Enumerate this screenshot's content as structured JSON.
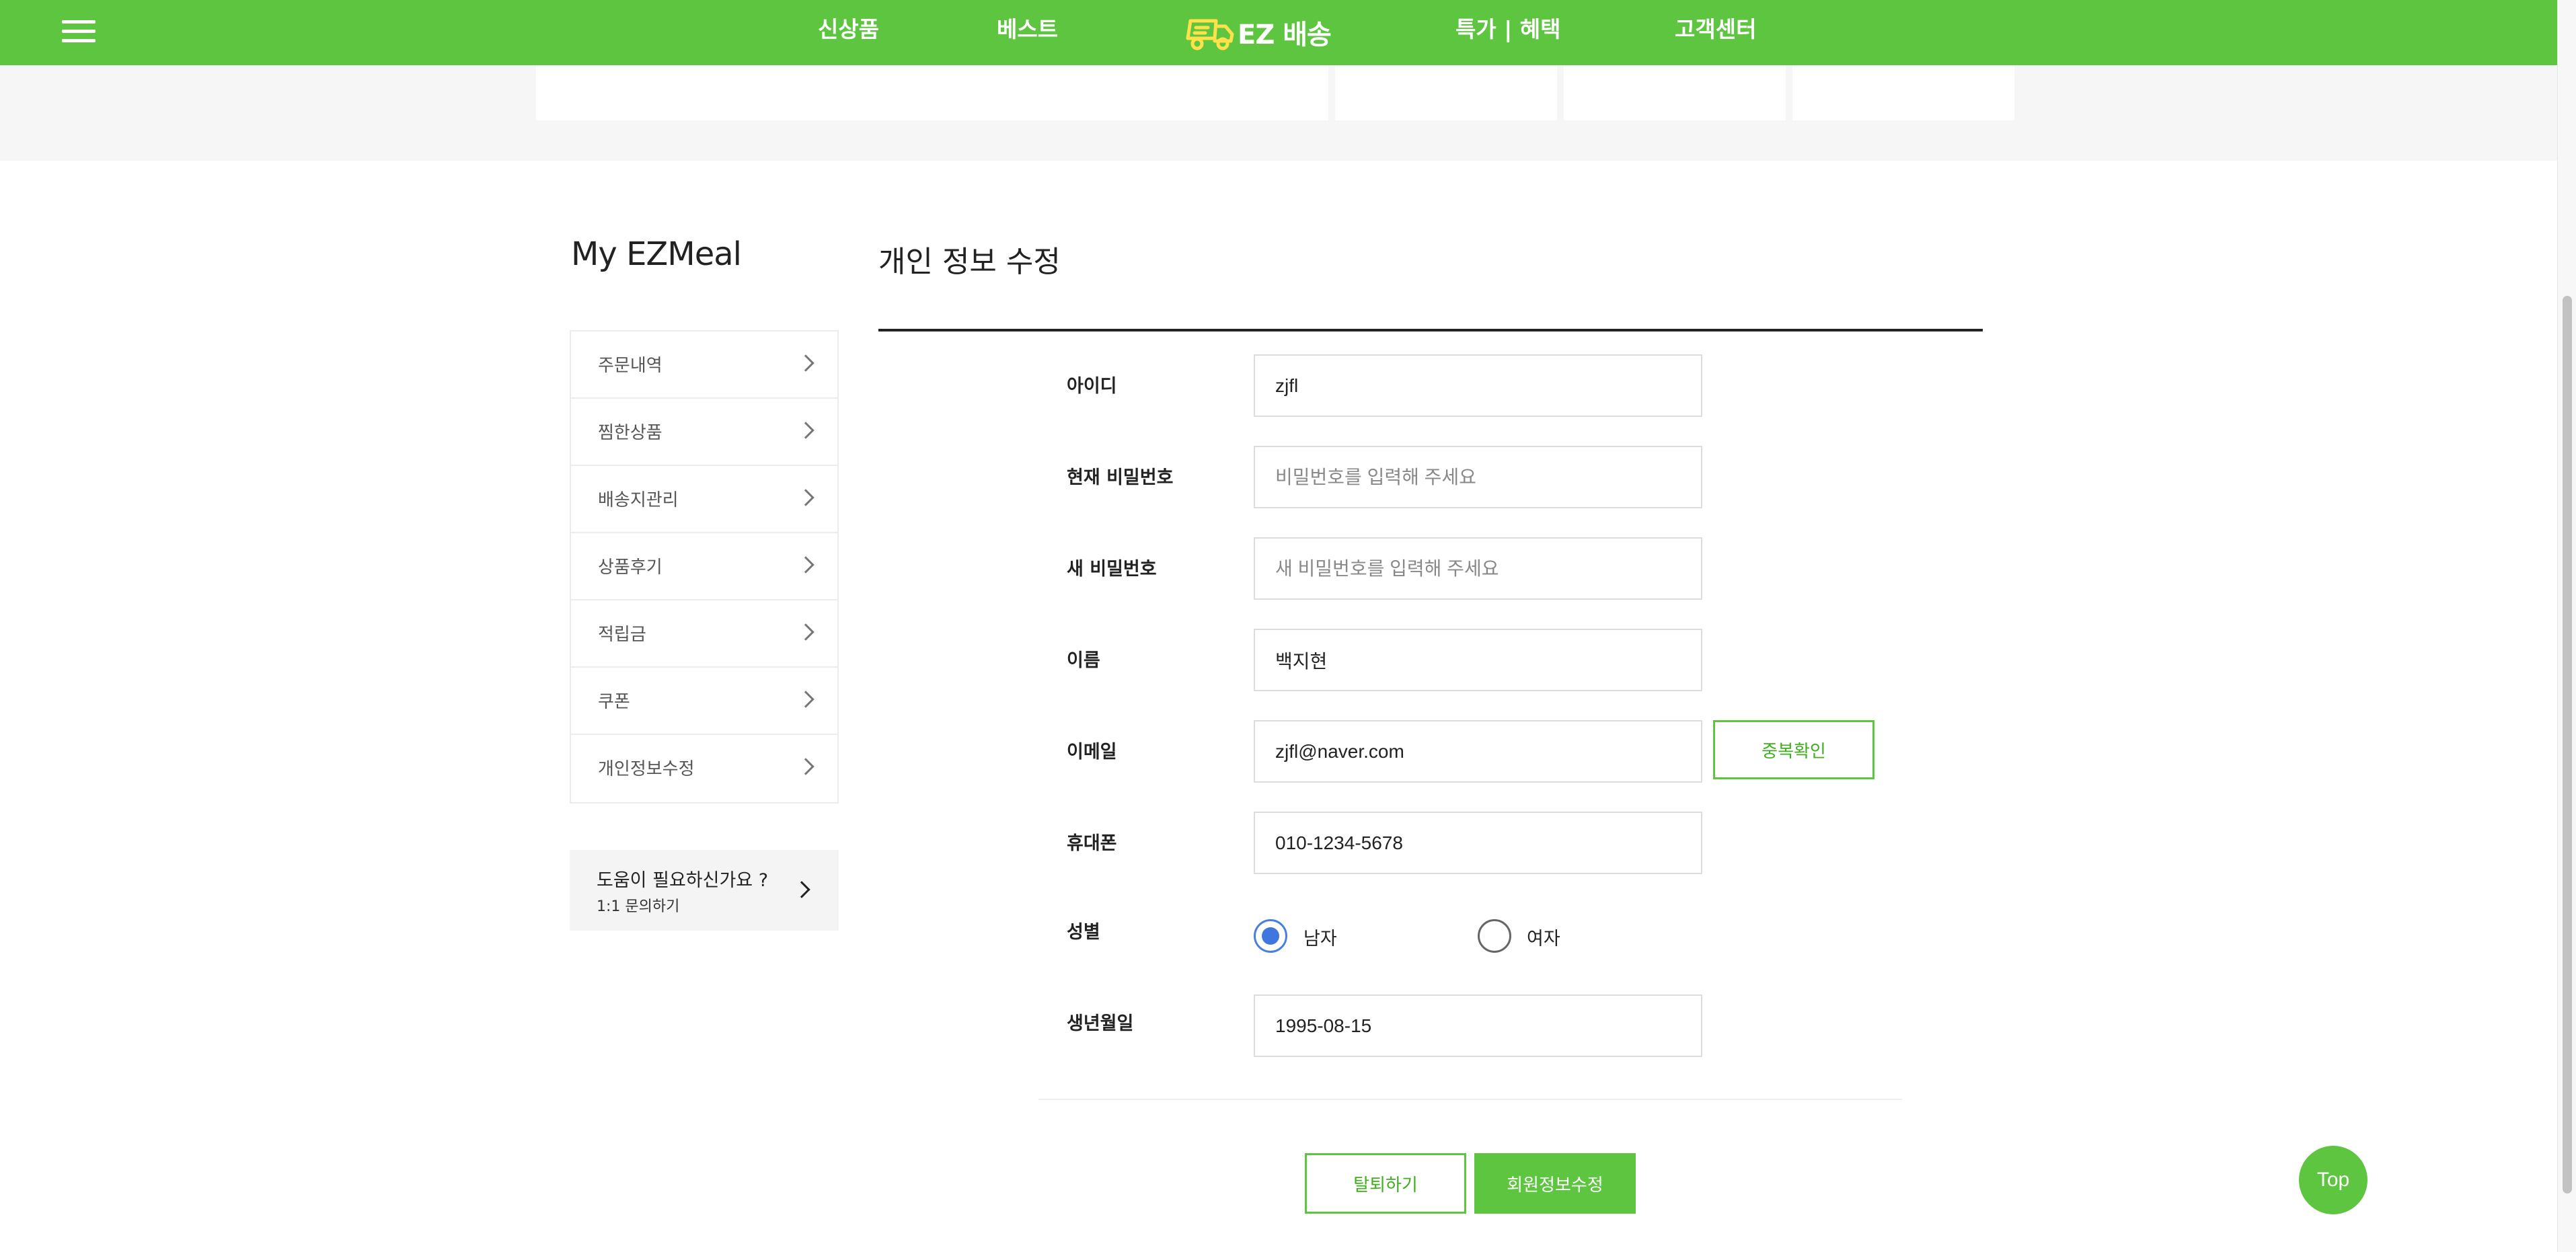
{
  "header": {
    "nav": [
      "신상품",
      "베스트",
      "특가 | 혜택",
      "고객센터"
    ],
    "logo_text": "EZ 배송",
    "brand_color": "#5dc53f"
  },
  "sidebar": {
    "title": "My EZMeal",
    "items": [
      {
        "label": "주문내역"
      },
      {
        "label": "찜한상품"
      },
      {
        "label": "배송지관리"
      },
      {
        "label": "상품후기"
      },
      {
        "label": "적립금"
      },
      {
        "label": "쿠폰"
      },
      {
        "label": "개인정보수정"
      }
    ],
    "help": {
      "title": "도움이 필요하신가요 ?",
      "subtitle": "1:1 문의하기"
    }
  },
  "main": {
    "title": "개인 정보 수정",
    "fields": {
      "id": {
        "label": "아이디",
        "value": "zjfl"
      },
      "current_password": {
        "label": "현재 비밀번호",
        "placeholder": "비밀번호를 입력해 주세요"
      },
      "new_password": {
        "label": "새 비밀번호",
        "placeholder": "새 비밀번호를 입력해 주세요"
      },
      "name": {
        "label": "이름",
        "value": "백지현"
      },
      "email": {
        "label": "이메일",
        "value": "zjfl@naver.com",
        "dup_check_label": "중복확인"
      },
      "phone": {
        "label": "휴대폰",
        "value": "010-1234-5678"
      },
      "gender": {
        "label": "성별",
        "options": [
          "남자",
          "여자"
        ],
        "selected": "남자"
      },
      "birth": {
        "label": "생년월일",
        "value": "1995-08-15"
      }
    },
    "buttons": {
      "withdraw": "탈퇴하기",
      "save": "회원정보수정"
    }
  },
  "top_button": "Top"
}
